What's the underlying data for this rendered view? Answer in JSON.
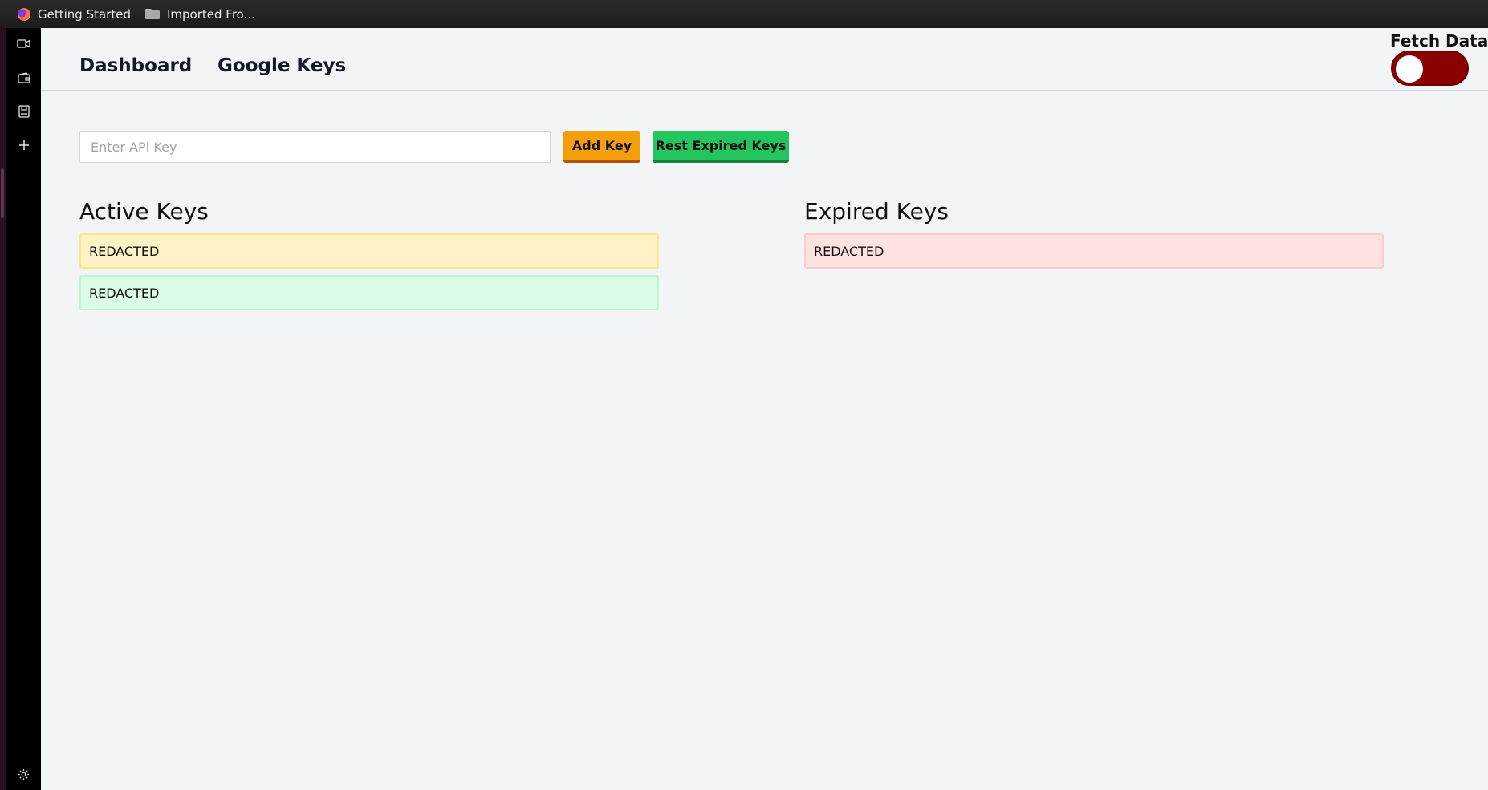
{
  "bookmarks": [
    {
      "label": "Getting Started",
      "icon": "firefox-icon"
    },
    {
      "label": "Imported Fro...",
      "icon": "folder-icon"
    }
  ],
  "sidebar": {
    "icons": [
      "video-icon",
      "wallet-icon",
      "save-icon",
      "plus-icon"
    ],
    "bottom_icon": "gear-icon"
  },
  "nav": {
    "links": [
      {
        "label": "Dashboard"
      },
      {
        "label": "Google Keys"
      }
    ],
    "fetch_data": {
      "label": "Fetch Data",
      "on": false
    }
  },
  "form": {
    "api_key_placeholder": "Enter API Key",
    "api_key_value": "",
    "add_button": "Add Key",
    "reset_button": "Rest Expired Keys"
  },
  "active_keys": {
    "title": "Active Keys",
    "items": [
      {
        "value": "REDACTED",
        "status": "warning"
      },
      {
        "value": "REDACTED",
        "status": "ok"
      }
    ]
  },
  "expired_keys": {
    "title": "Expired Keys",
    "items": [
      {
        "value": "REDACTED",
        "status": "expired"
      }
    ]
  },
  "colors": {
    "add_button": "#f59e0b",
    "reset_button": "#22c55e",
    "toggle_off": "#8b0000",
    "key_warning": "#fef3c7",
    "key_ok": "#dcfce7",
    "key_expired": "#fee2e2"
  }
}
